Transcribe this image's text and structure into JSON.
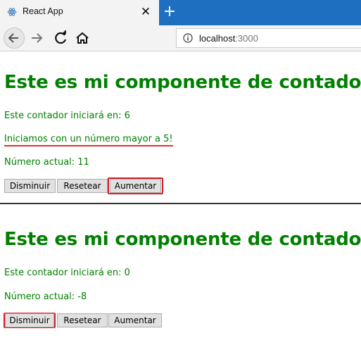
{
  "browser": {
    "tab_title": "React App",
    "tab_close_glyph": "✕",
    "new_tab_glyph": "+",
    "url_host": "localhost",
    "url_port": ":3000",
    "icons": [
      "react-favicon-icon",
      "back-icon",
      "forward-icon",
      "reload-icon",
      "home-icon",
      "info-icon"
    ]
  },
  "counters": [
    {
      "heading": "Este es mi componente de contador",
      "start_text": "Este contador iniciará en: 6",
      "message": "Iniciamos con un número mayor a 5!",
      "current_text": "Número actual: 11",
      "buttons": {
        "decrease": "Disminuir",
        "reset": "Resetear",
        "increase": "Aumentar"
      },
      "highlighted_button": "increase"
    },
    {
      "heading": "Este es mi componente de contador",
      "start_text": "Este contador iniciará en: 0",
      "current_text": "Número actual: -8",
      "buttons": {
        "decrease": "Disminuir",
        "reset": "Resetear",
        "increase": "Aumentar"
      },
      "highlighted_button": "decrease"
    }
  ],
  "colors": {
    "text_green": "#008000",
    "highlight_red": "#d21f2a",
    "tabstrip_blue": "#1f6fc0"
  }
}
